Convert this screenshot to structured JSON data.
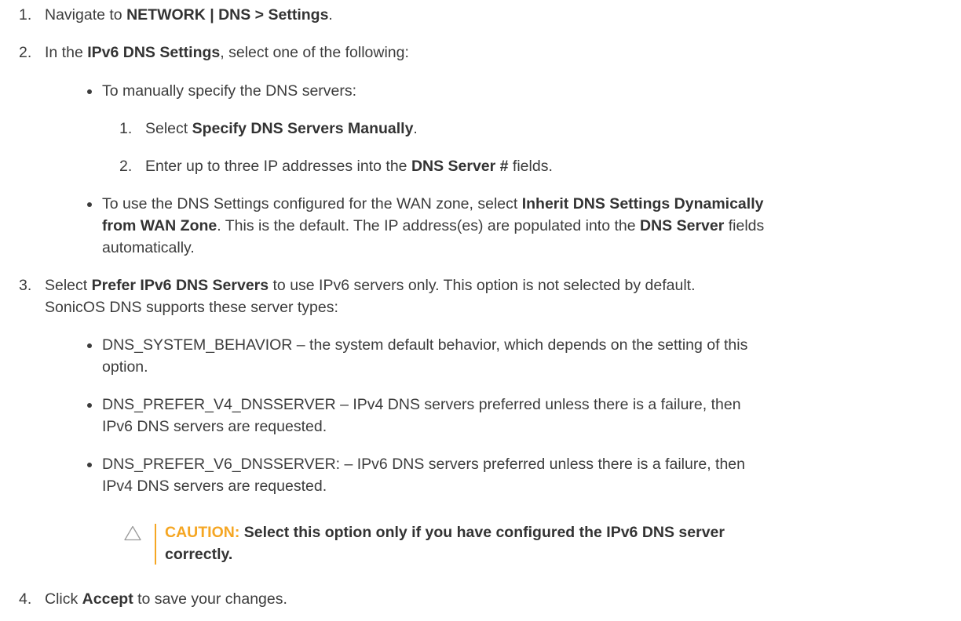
{
  "steps": {
    "s1": {
      "num": "1.",
      "pre": "Navigate to ",
      "b1": "NETWORK | DNS > Settings",
      "post": "."
    },
    "s2": {
      "num": "2.",
      "pre": "In the ",
      "b1": "IPv6 DNS Settings",
      "post": ", select one of the following:"
    },
    "s2a": {
      "text": "To manually specify the DNS servers:"
    },
    "s2a1": {
      "num": "1.",
      "pre": "Select ",
      "b1": "Specify DNS Servers Manually",
      "post": "."
    },
    "s2a2": {
      "num": "2.",
      "pre": "Enter up to three IP addresses into the ",
      "b1": "DNS Server #",
      "post": " fields."
    },
    "s2b": {
      "l1_pre": "To use the DNS Settings configured for the WAN zone, select ",
      "l1_b": "Inherit DNS Settings Dynamically",
      "l2_b": "from WAN Zone",
      "l2_mid": ". This is the default. The IP address(es) are populated into the ",
      "l2_b2": "DNS Server",
      "l2_post": " fields",
      "l3": "automatically."
    },
    "s3": {
      "num": "3.",
      "pre": "Select ",
      "b1": "Prefer IPv6 DNS Servers",
      "post": " to use IPv6 servers only. This option is not selected by default.",
      "l2": "SonicOS DNS supports these server types:"
    },
    "s3a": {
      "l1": "DNS_SYSTEM_BEHAVIOR – the system default behavior, which depends on the setting of this",
      "l2": "option."
    },
    "s3b": {
      "l1": "DNS_PREFER_V4_DNSSERVER – IPv4 DNS servers preferred unless there is a failure, then",
      "l2": "IPv6 DNS servers are requested."
    },
    "s3c": {
      "l1": "DNS_PREFER_V6_DNSSERVER: – IPv6 DNS servers preferred unless there is a failure, then",
      "l2": "IPv4 DNS servers are requested."
    },
    "caution": {
      "label": "CAUTION:",
      "l1": " Select this option only if you have configured the IPv6 DNS server",
      "l2": "correctly."
    },
    "s4": {
      "num": "4.",
      "pre": "Click ",
      "b1": "Accept",
      "post": " to save your changes."
    }
  },
  "colors": {
    "caution": "#f5a623",
    "text": "#3c3c3c"
  },
  "icons": {
    "caution": "caution-triangle-icon"
  }
}
